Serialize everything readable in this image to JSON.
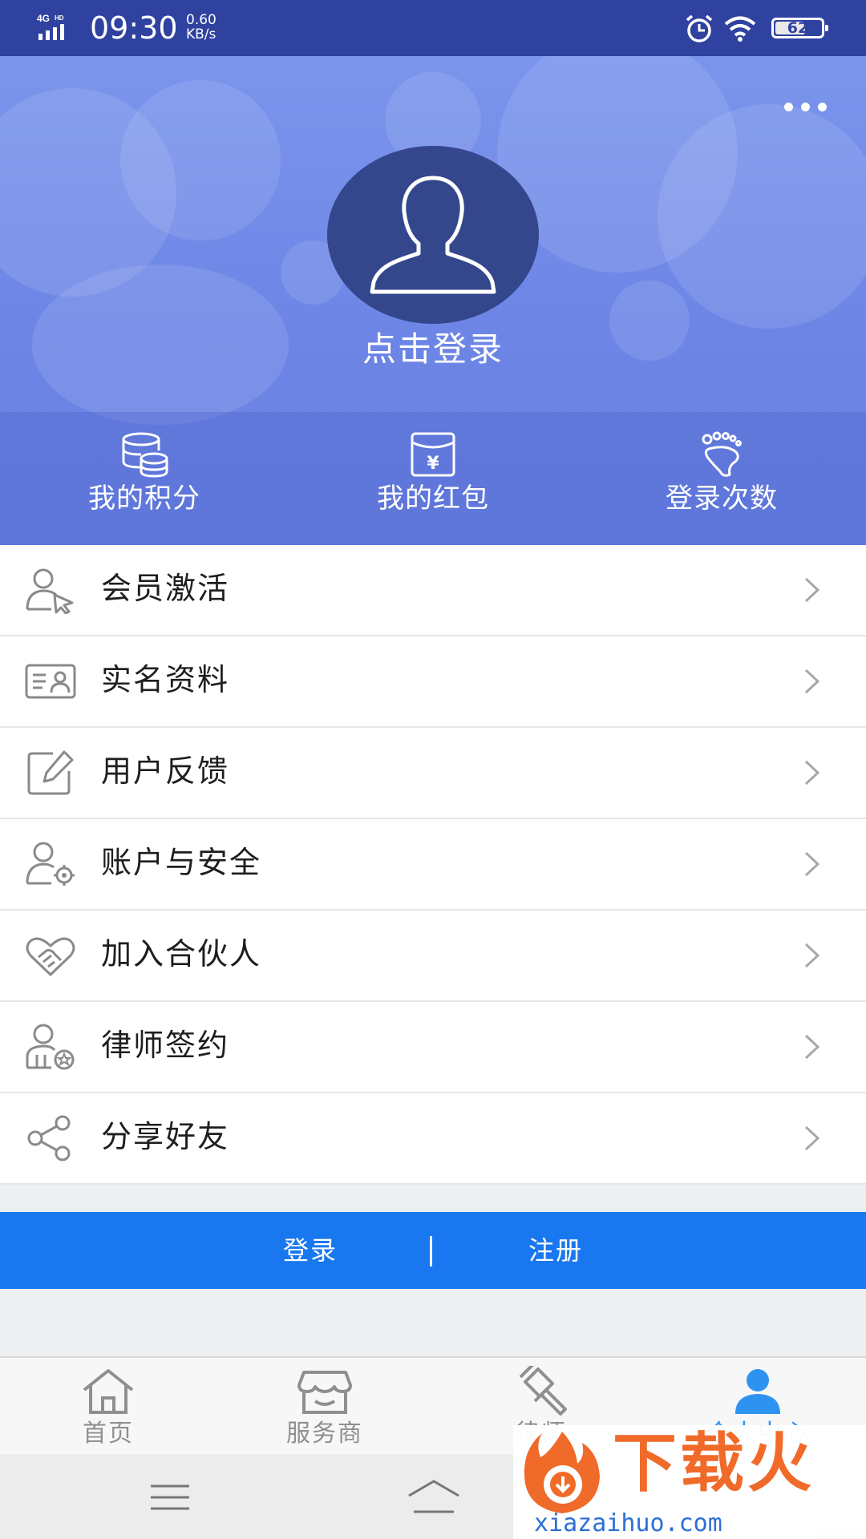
{
  "status_bar": {
    "network": "4G HD",
    "time": "09:30",
    "speed_value": "0.60",
    "speed_unit": "KB/s",
    "battery": "62"
  },
  "header": {
    "login_prompt": "点击登录",
    "more_icon": "more-horizontal-icon",
    "avatar_icon": "user-silhouette-icon",
    "stats": [
      {
        "label": "我的积分",
        "icon": "coins-stack-icon"
      },
      {
        "label": "我的红包",
        "icon": "red-envelope-yen-icon"
      },
      {
        "label": "登录次数",
        "icon": "footprint-icon"
      }
    ]
  },
  "menu": {
    "items": [
      {
        "label": "会员激活",
        "icon": "member-activate-icon"
      },
      {
        "label": "实名资料",
        "icon": "id-card-icon"
      },
      {
        "label": "用户反馈",
        "icon": "edit-feedback-icon"
      },
      {
        "label": "账户与安全",
        "icon": "user-settings-icon"
      },
      {
        "label": "加入合伙人",
        "icon": "handshake-heart-icon"
      },
      {
        "label": "律师签约",
        "icon": "lawyer-badge-icon"
      },
      {
        "label": "分享好友",
        "icon": "share-icon"
      }
    ]
  },
  "auth": {
    "login": "登录",
    "divider": "|",
    "register": "注册"
  },
  "tabbar": {
    "tabs": [
      {
        "label": "首页",
        "icon": "home-icon"
      },
      {
        "label": "服务商",
        "icon": "store-icon"
      },
      {
        "label": "律师",
        "icon": "gavel-icon"
      },
      {
        "label": "个人中心",
        "icon": "person-icon",
        "active": true
      }
    ]
  },
  "watermark": {
    "brand": "下载火",
    "url": "xiazaihuo.com"
  },
  "colors": {
    "status_bar": "#2f42a0",
    "header": "#7b95ec",
    "accent_blue": "#1978ef",
    "active_tab": "#2e93f0",
    "watermark_orange": "#f06a2a"
  }
}
